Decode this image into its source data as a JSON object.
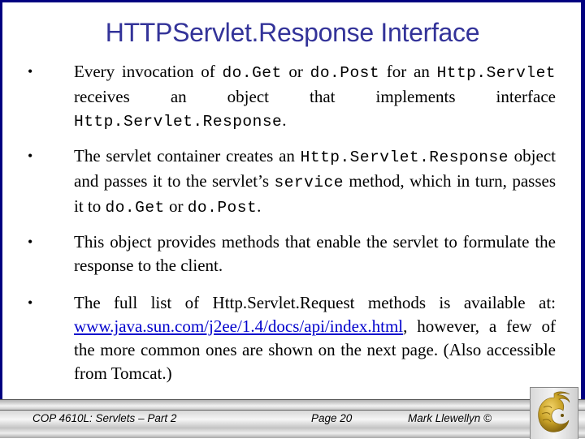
{
  "slide": {
    "title": "HTTPServlet.Response Interface",
    "bullets": [
      {
        "parts": [
          {
            "t": "Every invocation of ",
            "code": false
          },
          {
            "t": "do.Get",
            "code": true
          },
          {
            "t": " or ",
            "code": false
          },
          {
            "t": "do.Post",
            "code": true
          },
          {
            "t": " for an ",
            "code": false
          },
          {
            "t": "Http.Servlet",
            "code": true
          },
          {
            "t": "  receives an object that implements interface ",
            "code": false
          },
          {
            "t": "Http.Servlet.Response",
            "code": true
          },
          {
            "t": ".",
            "code": false
          }
        ]
      },
      {
        "parts": [
          {
            "t": "The servlet container creates an ",
            "code": false
          },
          {
            "t": "Http.Servlet.Response",
            "code": true
          },
          {
            "t": " object and passes it to the servlet’s ",
            "code": false
          },
          {
            "t": "service",
            "code": true
          },
          {
            "t": " method, which in turn, passes it to ",
            "code": false
          },
          {
            "t": "do.Get",
            "code": true
          },
          {
            "t": " or ",
            "code": false
          },
          {
            "t": "do.Post",
            "code": true
          },
          {
            "t": ".",
            "code": false
          }
        ]
      },
      {
        "parts": [
          {
            "t": "This object provides methods that enable the servlet to formulate the response to the client.",
            "code": false
          }
        ]
      },
      {
        "parts": [
          {
            "t": "The full list of Http.Servlet.Request methods is available at: ",
            "code": false
          },
          {
            "t": "www.java.sun.com/j2ee/1.4/docs/api/index.html",
            "link": true
          },
          {
            "t": ", however, a few of the more common ones are shown on the next page. (Also accessible from Tomcat.)",
            "code": false
          }
        ]
      }
    ],
    "bullet_glyph": "•"
  },
  "footer": {
    "course": "COP 4610L: Servlets – Part 2",
    "page": "Page 20",
    "author": "Mark Llewellyn ©",
    "logo": "ucf-pegasus-logo"
  },
  "colors": {
    "frame": "#000080",
    "title": "#333399",
    "link": "#0000cc",
    "logo_gold": "#c9a227"
  }
}
